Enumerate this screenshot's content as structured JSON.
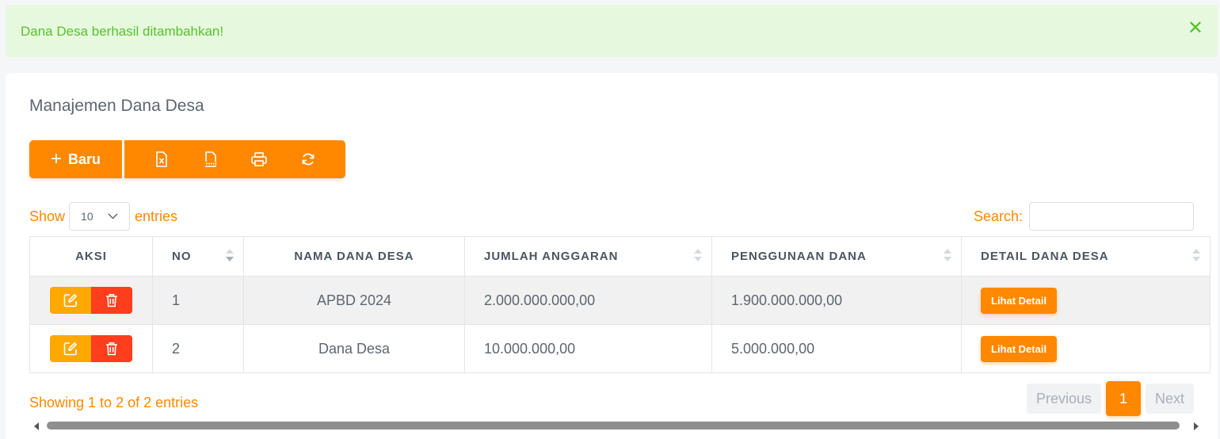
{
  "alert": {
    "message": "Dana Desa berhasil ditambahkan!",
    "close": "✕"
  },
  "card": {
    "title": "Manajemen Dana Desa"
  },
  "toolbar": {
    "new_label": "Baru",
    "plus": "+",
    "icons": [
      "excel-icon",
      "csv-icon",
      "print-icon",
      "refresh-icon"
    ]
  },
  "length": {
    "show": "Show",
    "value": "10",
    "entries": "entries"
  },
  "search": {
    "label": "Search:",
    "placeholder": "",
    "value": ""
  },
  "table": {
    "headers": [
      "AKSI",
      "NO",
      "NAMA DANA DESA",
      "JUMLAH ANGGARAN",
      "PENGGUNAAN DANA",
      "DETAIL DANA DESA"
    ],
    "rows": [
      {
        "no": "1",
        "nama": "APBD 2024",
        "jumlah": "2.000.000.000,00",
        "penggunaan": "1.900.000.000,00",
        "detail": "Lihat Detail"
      },
      {
        "no": "2",
        "nama": "Dana Desa",
        "jumlah": "10.000.000,00",
        "penggunaan": "5.000.000,00",
        "detail": "Lihat Detail"
      }
    ]
  },
  "info": "Showing 1 to 2 of 2 entries",
  "pagination": {
    "previous": "Previous",
    "current": "1",
    "next": "Next"
  },
  "colors": {
    "accent": "#ff8800",
    "success_text": "#57c22b",
    "success_bg": "#e6f9df",
    "edit": "#ffa800",
    "delete": "#ff3e1d"
  }
}
